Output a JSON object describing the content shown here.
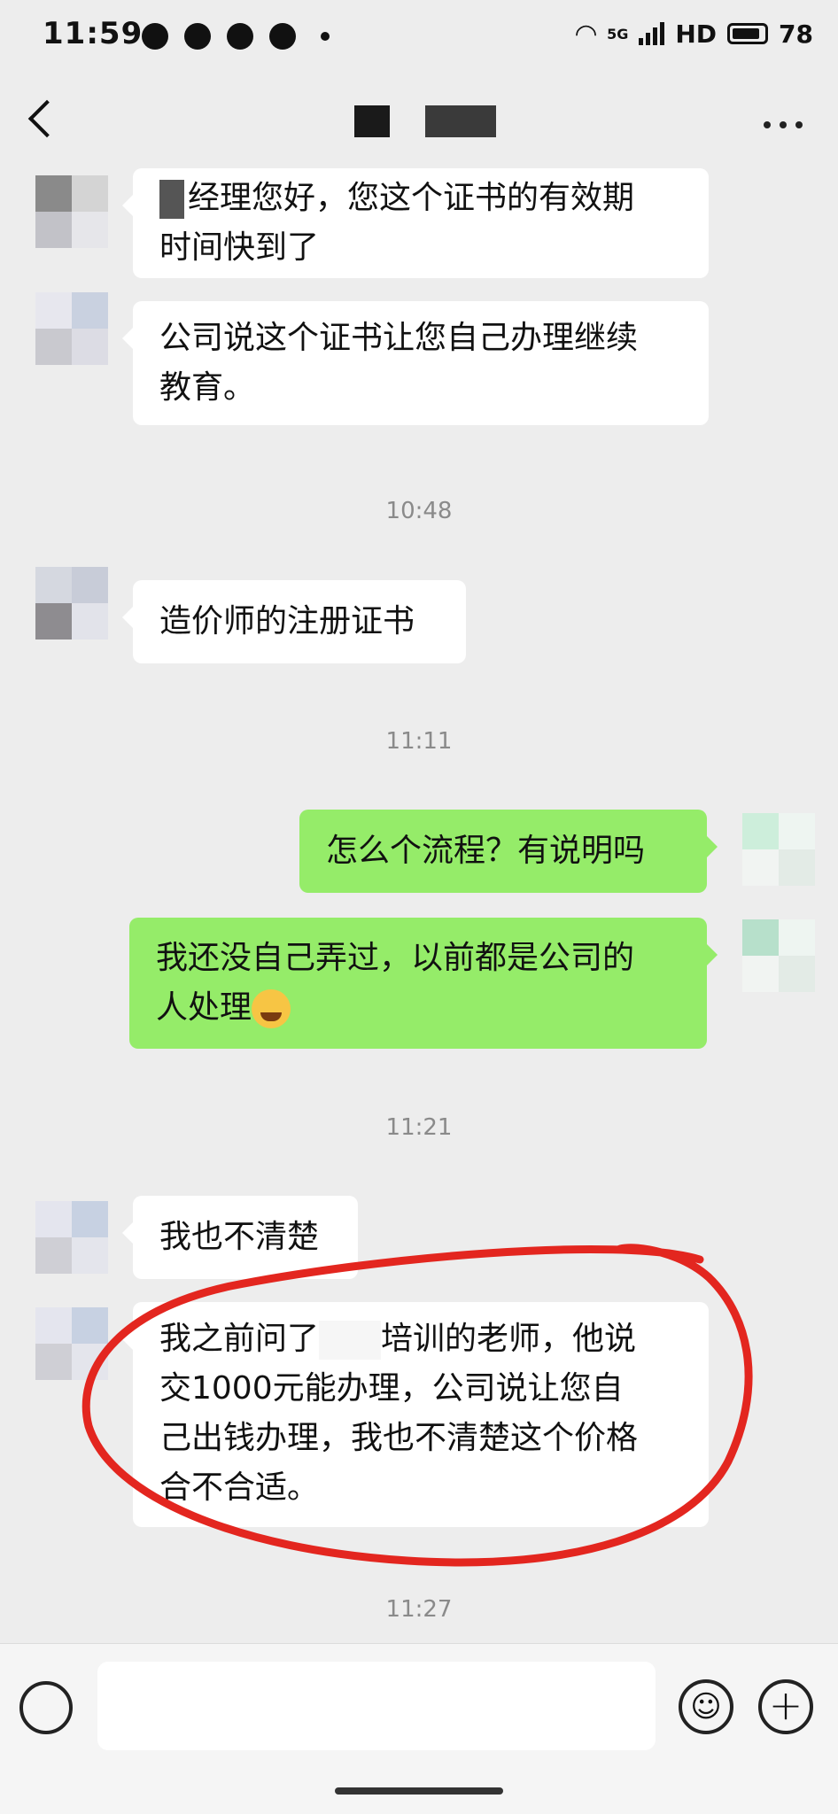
{
  "status_bar": {
    "time": "11:59",
    "network": "5G",
    "hd": "HD",
    "battery": "78"
  },
  "nav": {
    "back_icon": "chevron-left-icon",
    "more_icon": "more-dots-icon"
  },
  "messages": [
    {
      "dir": "in",
      "lines": [
        "经理您好，您这个证书的有效期",
        "时间快到了"
      ]
    },
    {
      "dir": "in",
      "lines": [
        "公司说这个证书让您自己办理继续",
        "教育。"
      ]
    },
    {
      "time": "10:48"
    },
    {
      "dir": "in",
      "lines": [
        "造价师的注册证书"
      ]
    },
    {
      "time": "11:11"
    },
    {
      "dir": "out",
      "lines": [
        "怎么个流程？有说明吗"
      ]
    },
    {
      "dir": "out",
      "lines": [
        "我还没自己弄过，以前都是公司的",
        "人处理"
      ]
    },
    {
      "time": "11:21"
    },
    {
      "dir": "in",
      "lines": [
        "我也不清楚"
      ]
    },
    {
      "dir": "in",
      "lines": [
        "我之前问了",
        "培训的老师，他说",
        "交1000元能办理，公司说让您自",
        "己出钱办理，我也不清楚这个价格",
        "合不合适。"
      ]
    },
    {
      "time": "11:27"
    }
  ],
  "colors": {
    "background": "#ededed",
    "incoming_bubble": "#ffffff",
    "outgoing_bubble": "#95ec69",
    "annotation_circle": "#e3261f"
  },
  "input_bar": {
    "voice_icon": "voice-icon",
    "emoji_icon": "emoji-smile-icon",
    "plus_icon": "plus-icon",
    "emoji_glyph": "☺",
    "plus_glyph": "+"
  }
}
